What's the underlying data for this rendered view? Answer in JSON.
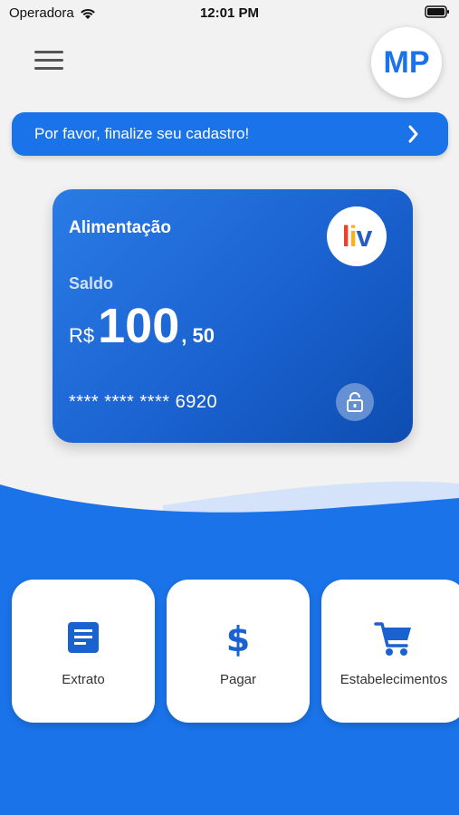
{
  "status_bar": {
    "carrier": "Operadora",
    "time": "12:01 PM"
  },
  "header": {
    "avatar_initials": "MP"
  },
  "banner": {
    "text": "Por favor, finalize seu cadastro!"
  },
  "card": {
    "title": "Alimentação",
    "logo_text": {
      "l": "l",
      "i": "i",
      "v": "v"
    },
    "balance_label": "Saldo",
    "currency": "R$",
    "amount_integer": "100",
    "amount_decimal": ", 50",
    "card_number": "**** **** **** 6920"
  },
  "actions": [
    {
      "label": "Extrato",
      "icon": "document-icon"
    },
    {
      "label": "Pagar",
      "icon": "dollar-icon"
    },
    {
      "label": "Estabelecimentos",
      "icon": "cart-icon"
    }
  ],
  "colors": {
    "primary": "#1a73e8",
    "card_dark": "#0e4db0",
    "background": "#f2f2f2"
  }
}
